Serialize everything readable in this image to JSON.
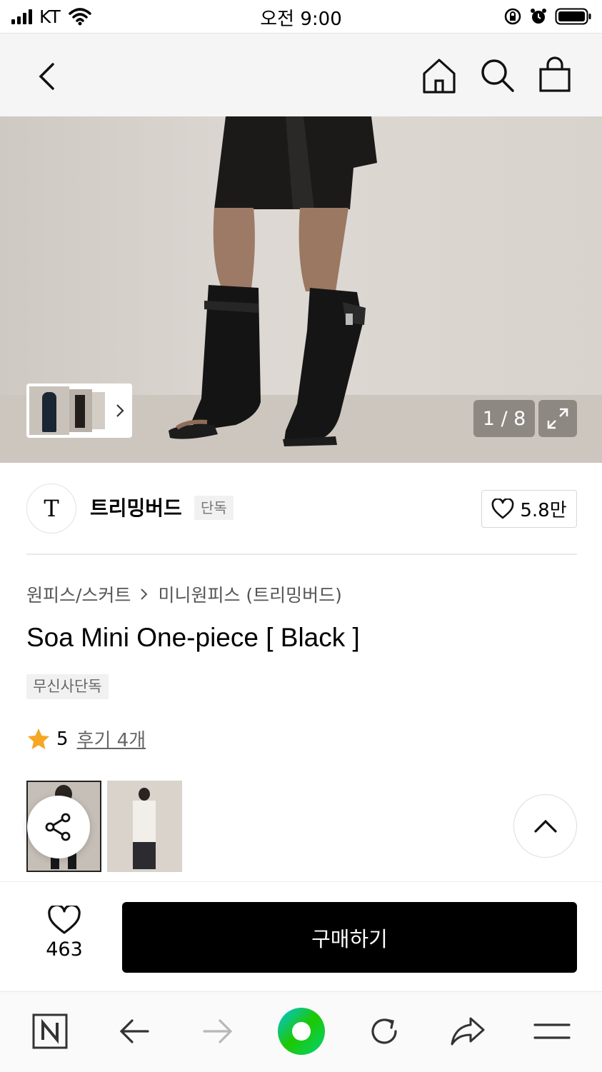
{
  "status_bar": {
    "carrier": "KT",
    "time": "오전 9:00"
  },
  "hero": {
    "counter": "1 / 8"
  },
  "brand": {
    "logo_letter": "T",
    "name": "트리밍버드",
    "tag": "단독",
    "likes": "5.8만"
  },
  "breadcrumb": {
    "category": "원피스/스커트",
    "subcategory": "미니원피스 (트리밍버드)"
  },
  "product": {
    "title": "Soa Mini One-piece [ Black ]",
    "badge": "무신사단독",
    "rating": "5",
    "reviews": "후기 4개"
  },
  "purchase": {
    "like_count": "463",
    "buy_label": "구매하기"
  },
  "colors": {
    "brand_green": "#1ec800",
    "star": "#f5a623"
  }
}
